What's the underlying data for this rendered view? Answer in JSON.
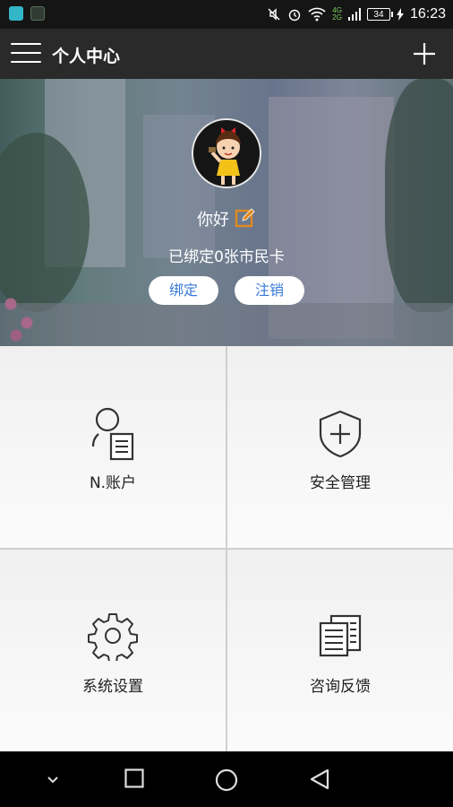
{
  "status_bar": {
    "battery": "34",
    "time": "16:23",
    "net_top": "4G",
    "net_bottom": "2G"
  },
  "header": {
    "title": "个人中心"
  },
  "profile": {
    "greeting": "你好",
    "bound_cards": "已绑定0张市民卡",
    "bind_button": "绑定",
    "logout_button": "注销"
  },
  "menu": [
    {
      "label": "N.账户",
      "icon": "account-search-icon"
    },
    {
      "label": "安全管理",
      "icon": "shield-plus-icon"
    },
    {
      "label": "系统设置",
      "icon": "gear-icon"
    },
    {
      "label": "咨询反馈",
      "icon": "documents-icon"
    }
  ],
  "colors": {
    "accent_blue": "#3a7ad8",
    "edit_orange": "#e08a1e",
    "appbar": "#2a2a2a"
  }
}
